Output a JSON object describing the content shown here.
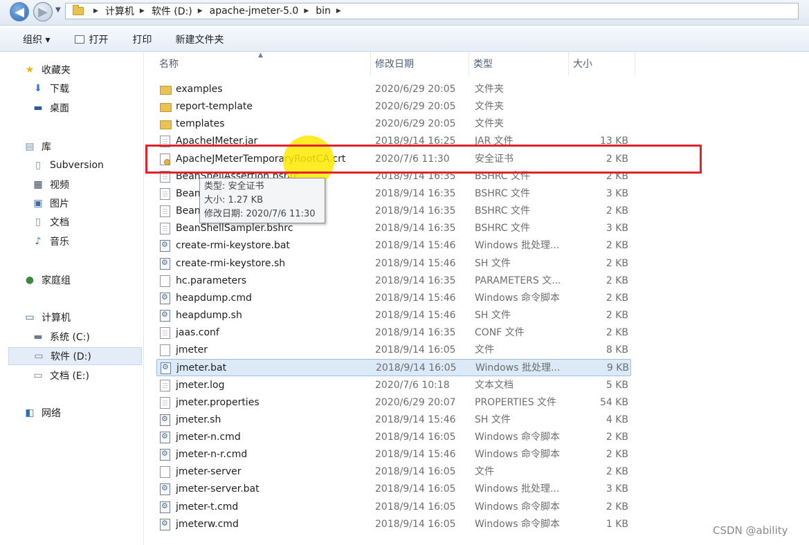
{
  "breadcrumb": {
    "items": [
      "计算机",
      "软件 (D:)",
      "apache-jmeter-5.0",
      "bin"
    ]
  },
  "toolbar": {
    "organize": "组织 ▾",
    "open": "打开",
    "print": "打印",
    "new_folder": "新建文件夹"
  },
  "navpane": {
    "favorites": "收藏夹",
    "downloads": "下载",
    "desktop": "桌面",
    "libraries": "库",
    "subversion": "Subversion",
    "videos": "视频",
    "pictures": "图片",
    "documents": "文档",
    "music": "音乐",
    "homegroup": "家庭组",
    "computer": "计算机",
    "drive_c": "系统 (C:)",
    "drive_d": "软件 (D:)",
    "drive_e": "文档 (E:)",
    "network": "网络"
  },
  "columns": {
    "name": "名称",
    "date": "修改日期",
    "type": "类型",
    "size": "大小"
  },
  "files": [
    {
      "name": "examples",
      "date": "2020/6/29 20:05",
      "type": "文件夹",
      "size": "",
      "icon": "folder-icon"
    },
    {
      "name": "report-template",
      "date": "2020/6/29 20:05",
      "type": "文件夹",
      "size": "",
      "icon": "folder-icon"
    },
    {
      "name": "templates",
      "date": "2020/6/29 20:05",
      "type": "文件夹",
      "size": "",
      "icon": "folder-icon"
    },
    {
      "name": "ApacheJMeter.jar",
      "date": "2018/9/14 16:25",
      "type": "JAR 文件",
      "size": "13 KB",
      "icon": "jar-file-icon"
    },
    {
      "name": "ApacheJMeterTemporaryRootCA.crt",
      "date": "2020/7/6 11:30",
      "type": "安全证书",
      "size": "2 KB",
      "icon": "certificate-icon"
    },
    {
      "name": "BeanShellAssertion.bshrc",
      "date": "2018/9/14 16:35",
      "type": "BSHRC 文件",
      "size": "2 KB",
      "icon": "document-icon"
    },
    {
      "name": "Bean",
      "date": "2018/9/14 16:35",
      "type": "BSHRC 文件",
      "size": "3 KB",
      "icon": "document-icon"
    },
    {
      "name": "Bean",
      "date": "2018/9/14 16:35",
      "type": "BSHRC 文件",
      "size": "2 KB",
      "icon": "document-icon"
    },
    {
      "name": "BeanShellSampler.bshrc",
      "date": "2018/9/14 16:35",
      "type": "BSHRC 文件",
      "size": "3 KB",
      "icon": "document-icon"
    },
    {
      "name": "create-rmi-keystore.bat",
      "date": "2018/9/14 15:46",
      "type": "Windows 批处理...",
      "size": "2 KB",
      "icon": "script-icon"
    },
    {
      "name": "create-rmi-keystore.sh",
      "date": "2018/9/14 15:46",
      "type": "SH 文件",
      "size": "2 KB",
      "icon": "script-icon"
    },
    {
      "name": "hc.parameters",
      "date": "2018/9/14 16:35",
      "type": "PARAMETERS 文...",
      "size": "2 KB",
      "icon": "blank-file-icon"
    },
    {
      "name": "heapdump.cmd",
      "date": "2018/9/14 15:46",
      "type": "Windows 命令脚本",
      "size": "2 KB",
      "icon": "script-icon"
    },
    {
      "name": "heapdump.sh",
      "date": "2018/9/14 15:46",
      "type": "SH 文件",
      "size": "2 KB",
      "icon": "script-icon"
    },
    {
      "name": "jaas.conf",
      "date": "2018/9/14 16:35",
      "type": "CONF 文件",
      "size": "2 KB",
      "icon": "document-icon"
    },
    {
      "name": "jmeter",
      "date": "2018/9/14 16:05",
      "type": "文件",
      "size": "8 KB",
      "icon": "blank-file-icon"
    },
    {
      "name": "jmeter.bat",
      "date": "2018/9/14 16:05",
      "type": "Windows 批处理...",
      "size": "9 KB",
      "icon": "script-icon",
      "selected": true
    },
    {
      "name": "jmeter.log",
      "date": "2020/7/6 10:18",
      "type": "文本文档",
      "size": "5 KB",
      "icon": "document-icon"
    },
    {
      "name": "jmeter.properties",
      "date": "2020/6/29 20:07",
      "type": "PROPERTIES 文件",
      "size": "54 KB",
      "icon": "document-icon"
    },
    {
      "name": "jmeter.sh",
      "date": "2018/9/14 15:46",
      "type": "SH 文件",
      "size": "4 KB",
      "icon": "script-icon"
    },
    {
      "name": "jmeter-n.cmd",
      "date": "2018/9/14 16:05",
      "type": "Windows 命令脚本",
      "size": "2 KB",
      "icon": "script-icon"
    },
    {
      "name": "jmeter-n-r.cmd",
      "date": "2018/9/14 15:46",
      "type": "Windows 命令脚本",
      "size": "2 KB",
      "icon": "script-icon"
    },
    {
      "name": "jmeter-server",
      "date": "2018/9/14 16:05",
      "type": "文件",
      "size": "2 KB",
      "icon": "blank-file-icon"
    },
    {
      "name": "jmeter-server.bat",
      "date": "2018/9/14 16:05",
      "type": "Windows 批处理...",
      "size": "3 KB",
      "icon": "script-icon"
    },
    {
      "name": "jmeter-t.cmd",
      "date": "2018/9/14 16:05",
      "type": "Windows 命令脚本",
      "size": "2 KB",
      "icon": "script-icon"
    },
    {
      "name": "jmeterw.cmd",
      "date": "2018/9/14 16:05",
      "type": "Windows 命令脚本",
      "size": "1 KB",
      "icon": "script-icon"
    }
  ],
  "tooltip": {
    "type_line": "类型: 安全证书",
    "size_line": "大小: 1.27 KB",
    "date_line": "修改日期: 2020/7/6 11:30"
  },
  "watermark": "CSDN @ability",
  "colors": {
    "highlight_red": "#e0202a",
    "highlight_yellow": "#ffe800",
    "selection": "#dce9f7"
  }
}
